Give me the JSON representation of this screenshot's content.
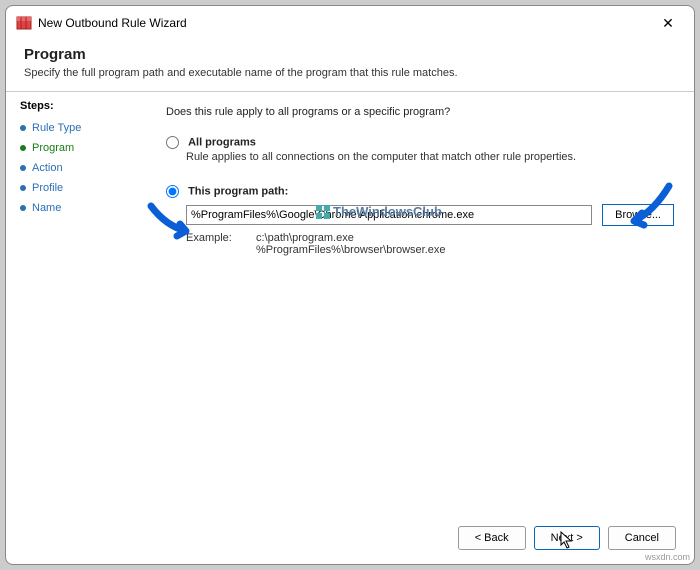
{
  "window": {
    "title": "New Outbound Rule Wizard"
  },
  "header": {
    "title": "Program",
    "subtitle": "Specify the full program path and executable name of the program that this rule matches."
  },
  "steps": {
    "heading": "Steps:",
    "items": [
      {
        "label": "Rule Type",
        "color": "blue"
      },
      {
        "label": "Program",
        "color": "green",
        "active": true
      },
      {
        "label": "Action",
        "color": "blue"
      },
      {
        "label": "Profile",
        "color": "blue"
      },
      {
        "label": "Name",
        "color": "blue"
      }
    ]
  },
  "content": {
    "question": "Does this rule apply to all programs or a specific program?",
    "option_all": {
      "label": "All programs",
      "desc": "Rule applies to all connections on the computer that match other rule properties."
    },
    "option_path": {
      "label": "This program path:",
      "value": "%ProgramFiles%\\Google\\Chrome\\Application\\chrome.exe",
      "browse": "Browse..."
    },
    "example": {
      "label": "Example:",
      "values": "c:\\path\\program.exe\n%ProgramFiles%\\browser\\browser.exe"
    }
  },
  "footer": {
    "back": "< Back",
    "next": "Next >",
    "cancel": "Cancel"
  },
  "watermark": {
    "twc": "TheWindowsClub",
    "corner": "wsxdn.com"
  }
}
